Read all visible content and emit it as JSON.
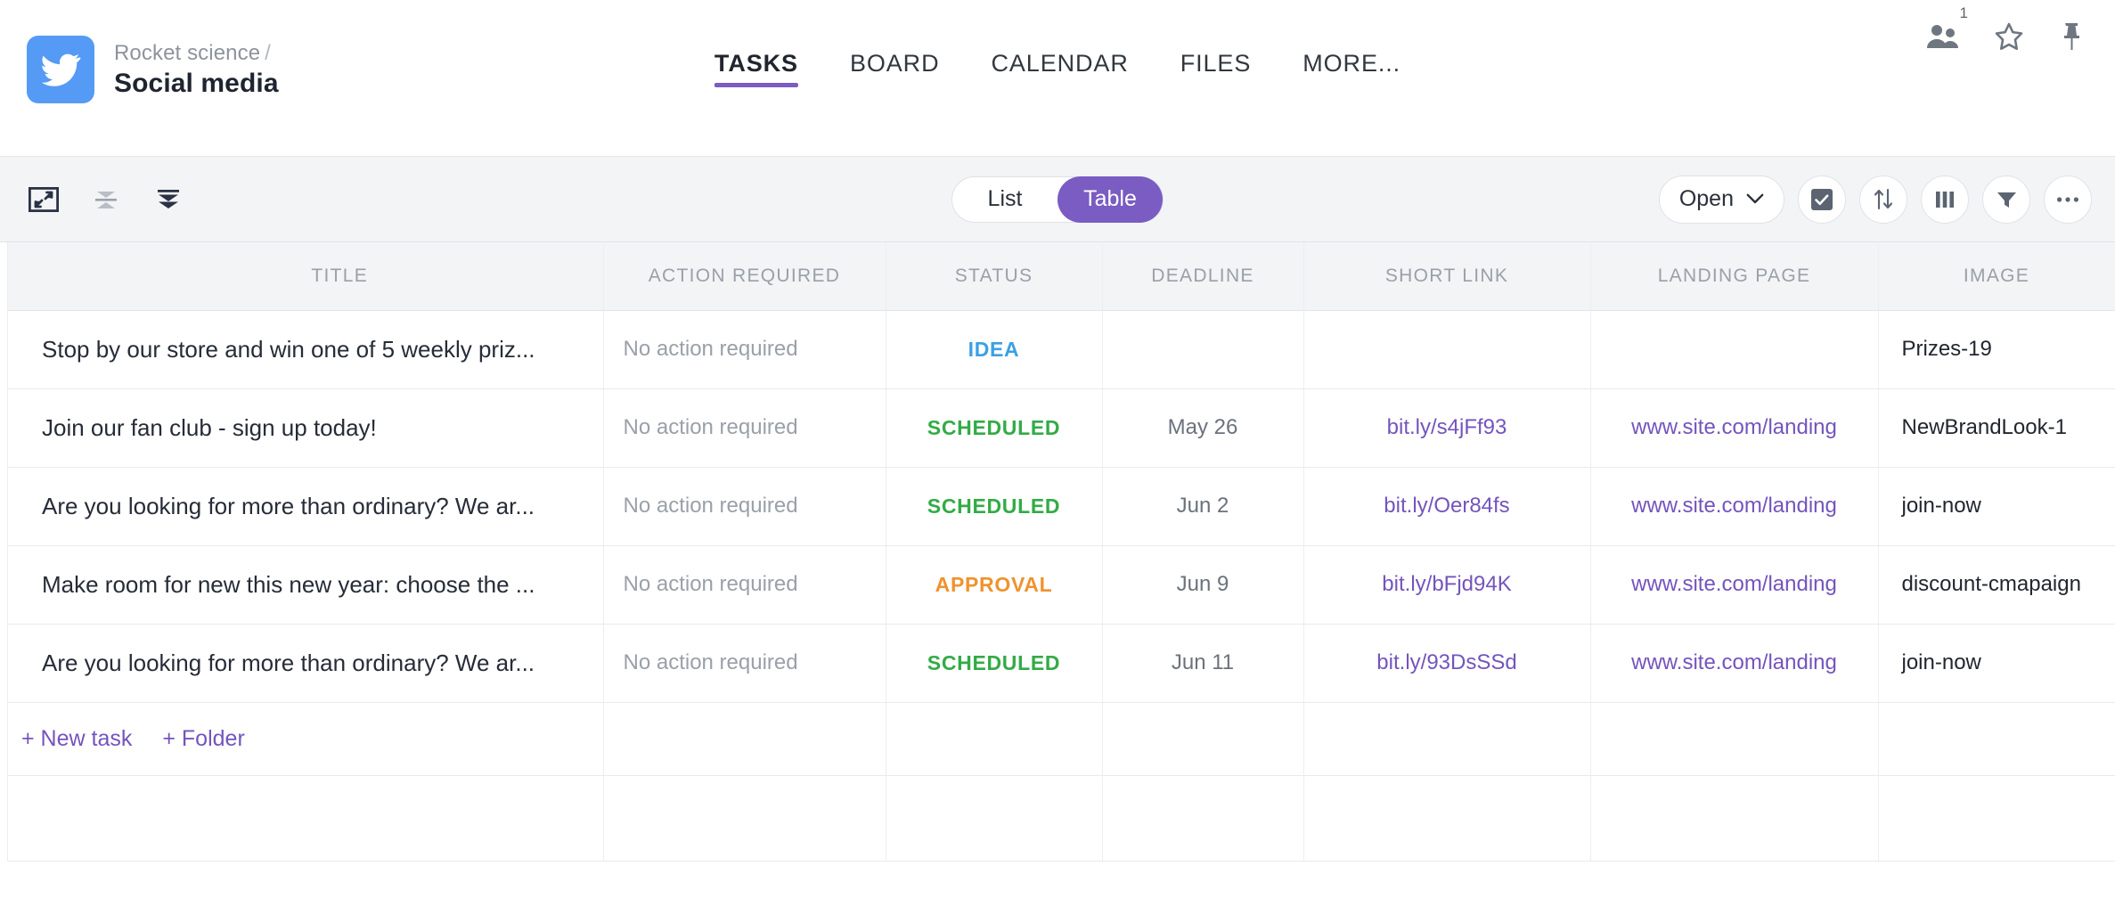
{
  "header": {
    "logo_icon": "twitter-bird-icon",
    "breadcrumb_parent": "Rocket science",
    "breadcrumb_separator": "/",
    "page_title": "Social media",
    "tabs": [
      {
        "label": "TASKS",
        "active": true
      },
      {
        "label": "BOARD",
        "active": false
      },
      {
        "label": "CALENDAR",
        "active": false
      },
      {
        "label": "FILES",
        "active": false
      },
      {
        "label": "MORE...",
        "active": false
      }
    ],
    "icons": [
      {
        "name": "people-icon",
        "badge": "1"
      },
      {
        "name": "star-icon",
        "badge": ""
      },
      {
        "name": "pin-icon",
        "badge": ""
      }
    ]
  },
  "toolbar": {
    "left_icons": [
      {
        "name": "expand-fullscreen-icon"
      },
      {
        "name": "collapse-all-icon"
      },
      {
        "name": "expand-all-icon"
      }
    ],
    "view_switch": {
      "options": [
        {
          "label": "List",
          "active": false
        },
        {
          "label": "Table",
          "active": true
        }
      ]
    },
    "filter_label": "Open",
    "right_icons": [
      {
        "name": "checkbox-icon"
      },
      {
        "name": "sort-icon"
      },
      {
        "name": "columns-icon"
      },
      {
        "name": "filter-funnel-icon"
      },
      {
        "name": "more-options-icon"
      }
    ]
  },
  "table": {
    "columns": [
      "TITLE",
      "ACTION REQUIRED",
      "STATUS",
      "DEADLINE",
      "SHORT LINK",
      "LANDING PAGE",
      "IMAGE"
    ],
    "rows": [
      {
        "title": "Stop by our store and win one of 5 weekly priz...",
        "action_required": "No action required",
        "status": "IDEA",
        "status_class": "st-idea",
        "deadline": "",
        "short_link": "",
        "landing_page": "",
        "image": "Prizes-19"
      },
      {
        "title": "Join our fan club - sign up today!",
        "action_required": "No action required",
        "status": "SCHEDULED",
        "status_class": "st-scheduled",
        "deadline": "May 26",
        "short_link": "bit.ly/s4jFf93",
        "landing_page": "www.site.com/landing",
        "image": "NewBrandLook-1"
      },
      {
        "title": "Are you looking for more than ordinary? We ar...",
        "action_required": "No action required",
        "status": "SCHEDULED",
        "status_class": "st-scheduled",
        "deadline": "Jun 2",
        "short_link": "bit.ly/Oer84fs",
        "landing_page": "www.site.com/landing",
        "image": "join-now"
      },
      {
        "title": "Make room for new this new year: choose the ...",
        "action_required": "No action required",
        "status": "APPROVAL",
        "status_class": "st-approval",
        "deadline": "Jun 9",
        "short_link": "bit.ly/bFjd94K",
        "landing_page": "www.site.com/landing",
        "image": "discount-cmapaign"
      },
      {
        "title": "Are you looking for more than ordinary? We ar...",
        "action_required": "No action required",
        "status": "SCHEDULED",
        "status_class": "st-scheduled",
        "deadline": "Jun 11",
        "short_link": "bit.ly/93DsSSd",
        "landing_page": "www.site.com/landing",
        "image": "join-now"
      }
    ],
    "add_new_task_label": "+ New task",
    "add_folder_label": "+ Folder"
  },
  "colors": {
    "accent": "#7a5cc2",
    "brand": "#559bf5",
    "link": "#7454bd",
    "status_idea": "#3ba0e4",
    "status_scheduled": "#33ab47",
    "status_approval": "#f0922f",
    "toolbar_bg": "#f2f4f6"
  }
}
